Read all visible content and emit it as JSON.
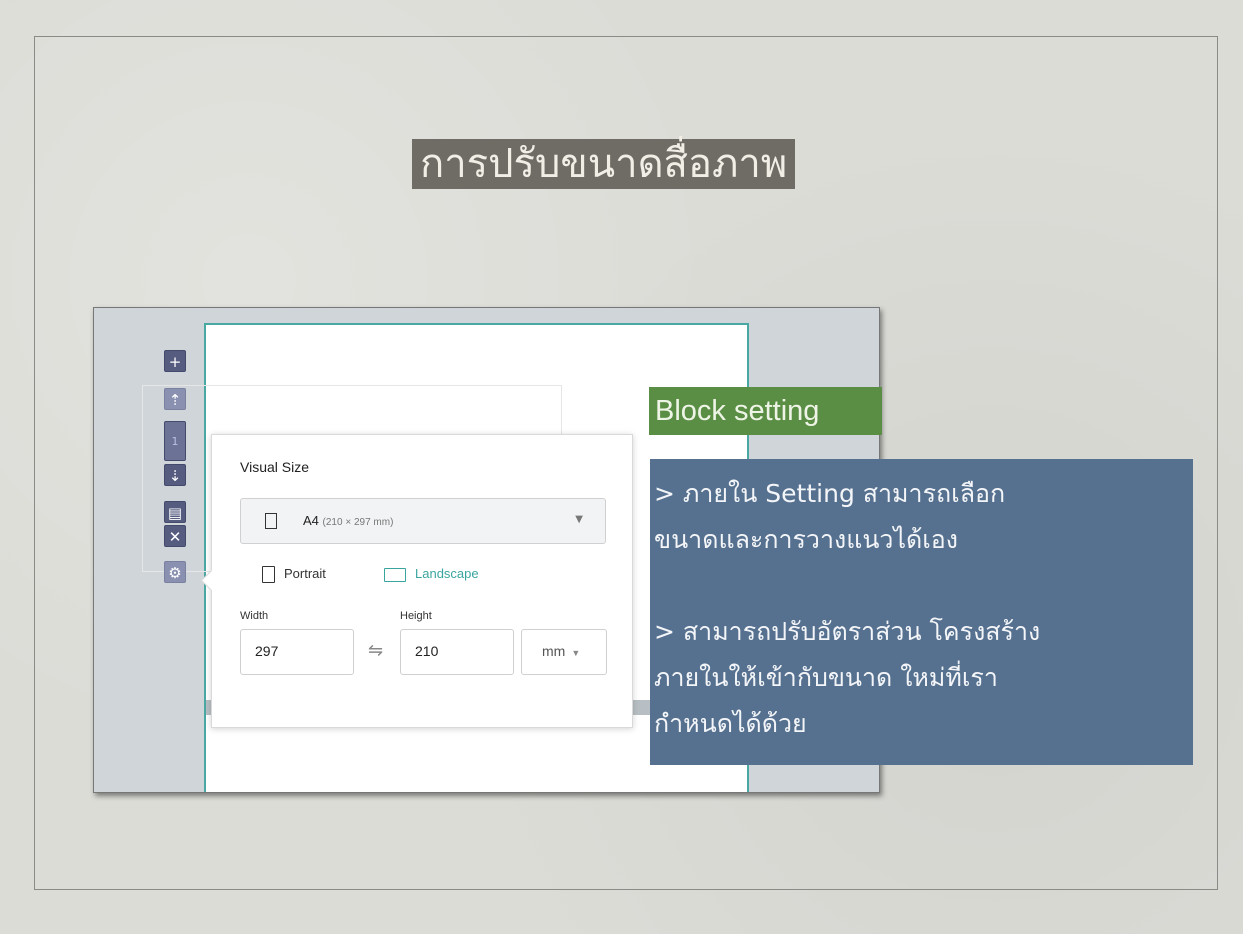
{
  "slide": {
    "title": "การปรับขนาดสื่อภาพ",
    "callout_label": "Block setting",
    "description_lines": [
      "> ภายใน Setting สามารถเลือก",
      "ขนาดและการวางแนวได้เอง",
      "> สามารถปรับอัตราส่วน โครงสร้าง",
      "ภายในให้เข้ากับขนาด ใหม่ที่เรา",
      "กำหนดได้ด้วย"
    ]
  },
  "toolbar": {
    "add_icon": "+",
    "page_number": "1",
    "layout_icon": "▤",
    "delete_icon": "✕",
    "settings_icon": "⚙"
  },
  "popup": {
    "title": "Visual Size",
    "size_select": {
      "value": "A4",
      "sub": "(210 × 297 mm)"
    },
    "orientation": {
      "portrait": "Portrait",
      "landscape": "Landscape",
      "selected": "Landscape"
    },
    "width_label": "Width",
    "height_label": "Height",
    "width_value": "297",
    "height_value": "210",
    "swap_icon": "⇋",
    "unit": "mm"
  },
  "colors": {
    "accent": "#3aa59f",
    "toolbar": "#565c80",
    "callout_green": "#5b8e45",
    "callout_blue": "#56718f",
    "title_bg": "#6f6c65"
  }
}
